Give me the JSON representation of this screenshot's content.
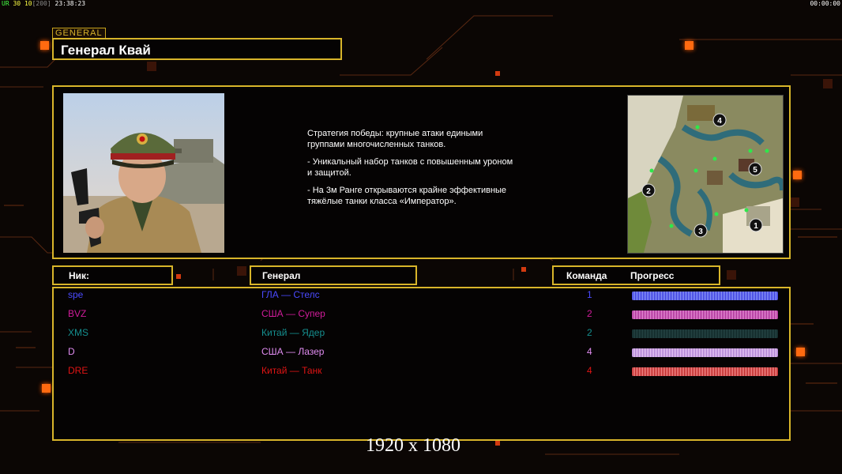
{
  "hud": {
    "left_prefix": "UR",
    "left_fps": "30",
    "left_val": "10",
    "left_limit": "[200]",
    "left_time": "23:38:23",
    "right_time": "00:00:00"
  },
  "general_tag": "GENERAL",
  "title": "Генерал Квай",
  "description": [
    "Стратегия победы: крупные атаки едиными\n группами многочисленных танков.",
    "- Уникальный набор танков с повышенным уроном\n и защитой.",
    "- На 3м Ранге открываются крайне эффективные\n тяжёлые танки класса «Император»."
  ],
  "headers": {
    "nick": "Ник:",
    "general": "Генерал",
    "team": "Команда",
    "progress": "Прогресс"
  },
  "minimap_markers": [
    "4",
    "5",
    "2",
    "3",
    "1"
  ],
  "players": [
    {
      "nick": "spe",
      "general": "ГЛА — Стелс",
      "team": "1",
      "color": "#4a4aff",
      "bar": "blue"
    },
    {
      "nick": "BVZ",
      "general": "США — Супер",
      "team": "2",
      "color": "#d01c9a",
      "bar": "magenta"
    },
    {
      "nick": "XMS",
      "general": "Китай — Ядер",
      "team": "2",
      "color": "#158f8f",
      "bar": "dark"
    },
    {
      "nick": "D",
      "general": "США — Лазер",
      "team": "4",
      "color": "#e08cf0",
      "bar": "lilac"
    },
    {
      "nick": "DRE",
      "general": "Китай — Танк",
      "team": "4",
      "color": "#e01414",
      "bar": "red"
    }
  ],
  "resolution": "1920 x 1080",
  "colors": {
    "accent": "#d8b52a",
    "orange": "#ff6a10"
  }
}
